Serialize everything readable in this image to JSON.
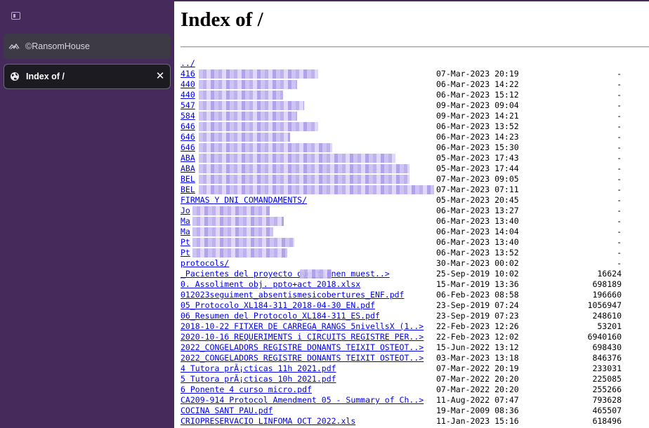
{
  "sidebar": {
    "tabs": [
      {
        "label": "©RansomHouse",
        "icon": "ransomhouse-logo-icon",
        "active": false
      },
      {
        "label": "Index of /",
        "icon": "globe-icon",
        "active": true,
        "close": "✕"
      }
    ]
  },
  "page": {
    "title": "Index of /",
    "parent_link": "../",
    "entries": [
      {
        "name": "416",
        "date": "07-Mar-2023 20:19",
        "size": "-"
      },
      {
        "name": "440",
        "date": "06-Mar-2023 14:22",
        "size": "-"
      },
      {
        "name": "440",
        "date": "06-Mar-2023 15:12",
        "size": "-"
      },
      {
        "name": "547",
        "date": "09-Mar-2023 09:04",
        "size": "-"
      },
      {
        "name": "584",
        "date": "09-Mar-2023 14:21",
        "size": "-"
      },
      {
        "name": "646",
        "date": "06-Mar-2023 13:52",
        "size": "-"
      },
      {
        "name": "646",
        "date": "06-Mar-2023 14:23",
        "size": "-"
      },
      {
        "name": "646",
        "date": "06-Mar-2023 15:30",
        "size": "-"
      },
      {
        "name": "ABA",
        "date": "05-Mar-2023 17:43",
        "size": "-"
      },
      {
        "name": "ABA",
        "date": "05-Mar-2023 17:44",
        "size": "-"
      },
      {
        "name": "BEL",
        "date": "07-Mar-2023 09:05",
        "size": "-"
      },
      {
        "name": "BEL",
        "date": "07-Mar-2023 07:11",
        "size": "-"
      },
      {
        "name": "FIRMAS Y DNI COMANDAMENTS/",
        "date": "05-Mar-2023 20:45",
        "size": "-"
      },
      {
        "name": "Jo",
        "date": "06-Mar-2023 13:27",
        "size": "-"
      },
      {
        "name": "Ma",
        "date": "06-Mar-2023 13:40",
        "size": "-"
      },
      {
        "name": "Ma",
        "date": "06-Mar-2023 14:04",
        "size": "-"
      },
      {
        "name": "Pt",
        "date": "06-Mar-2023 13:40",
        "size": "-"
      },
      {
        "name": "Pt",
        "date": "06-Mar-2023 13:52",
        "size": "-"
      },
      {
        "name": "protocols/",
        "date": "30-Mar-2023 00:02",
        "size": "-"
      },
      {
        "name": "_Pacientes del proyecto       que tienen muest..>",
        "date": "25-Sep-2019 10:02",
        "size": "16624"
      },
      {
        "name": "0. Assoliment obj. ppto+act 2018.xlsx",
        "date": "15-Mar-2019 13:36",
        "size": "698189"
      },
      {
        "name": "012023seguiment_absentismesicobertures_ENF.pdf",
        "date": "06-Feb-2023 08:58",
        "size": "196660"
      },
      {
        "name": "05_Protocolo_XL184-311_2018-04-30_EN.pdf",
        "date": "23-Sep-2019 07:24",
        "size": "1056947"
      },
      {
        "name": "06_Resumen del Protocolo_XL184-311_ES.pdf",
        "date": "23-Sep-2019 07:23",
        "size": "248610"
      },
      {
        "name": "2018-10-22 FITXER DE CARREGA_RANGS 5nivellsX (1..>",
        "date": "22-Feb-2023 12:26",
        "size": "53201"
      },
      {
        "name": "2020-10-16 REQUERIMENTS i CIRCUITS REGISTRE PER..>",
        "date": "22-Feb-2023 12:02",
        "size": "6940160"
      },
      {
        "name": "2022_CONGELADORS REGISTRE DONANTS TEIXIT OSTEOT..>",
        "date": "15-Jun-2022 13:12",
        "size": "698430"
      },
      {
        "name": "2022_CONGELADORS REGISTRE DONANTS TEIXIT OSTEOT..>",
        "date": "03-Mar-2023 13:18",
        "size": "846376"
      },
      {
        "name": "4 Tutora prÃ¡cticas 11h 2021.pdf",
        "date": "07-Mar-2022 20:19",
        "size": "233031"
      },
      {
        "name": "5 Tutora prÃ¡cticas 10h 2021.pdf",
        "date": "07-Mar-2022 20:20",
        "size": "225085"
      },
      {
        "name": "6 Ponente 4 curso micro.pdf",
        "date": "07-Mar-2022 20:20",
        "size": "255266"
      },
      {
        "name": "CA209-914 Protocol Amendment 05 - Summary of Ch..>",
        "date": "11-Aug-2022 07:47",
        "size": "793628"
      },
      {
        "name": "COCINA SANT PAU.pdf",
        "date": "19-Mar-2009 08:36",
        "size": "465507"
      },
      {
        "name": "CRIOPRESERVACIO LINFOMA OCT 2022.xls",
        "date": "11-Jan-2023 15:16",
        "size": "618496"
      }
    ]
  }
}
